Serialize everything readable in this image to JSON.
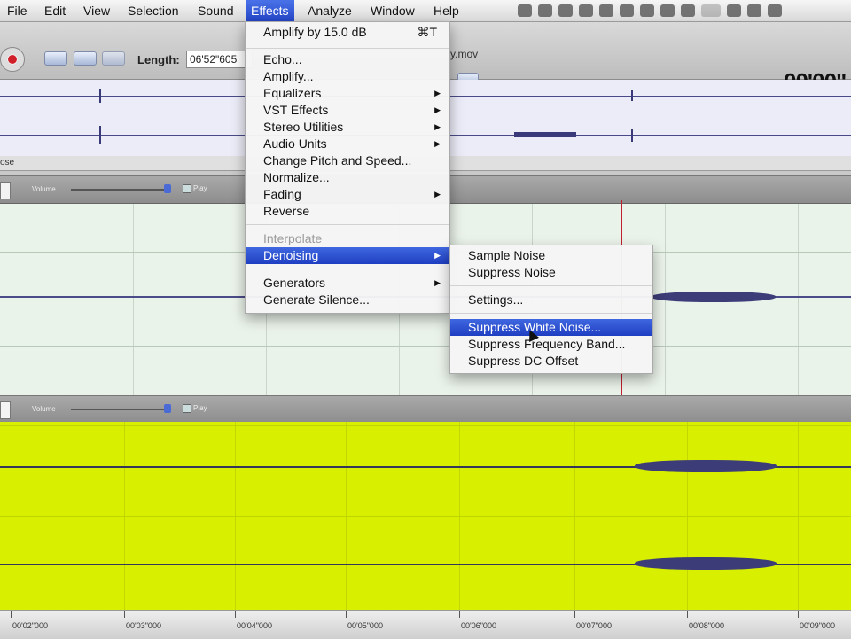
{
  "menubar": {
    "items": [
      "File",
      "Edit",
      "View",
      "Selection",
      "Sound",
      "Effects",
      "Analyze",
      "Window",
      "Help"
    ],
    "active": "Effects"
  },
  "toolbar": {
    "length_label": "Length:",
    "length_value": "06'52\"605",
    "file_title": "y.mov",
    "time_display": "00'00\""
  },
  "overview": {
    "label": "ose"
  },
  "track_header": {
    "volume_label": "Volume",
    "play_label": "Play"
  },
  "effects_menu": {
    "items": [
      {
        "label": "Amplify by 15.0 dB",
        "shortcut": "⌘T"
      },
      {
        "label": "Echo..."
      },
      {
        "label": "Amplify..."
      },
      {
        "label": "Equalizers",
        "submenu": true
      },
      {
        "label": "VST Effects",
        "submenu": true
      },
      {
        "label": "Stereo Utilities",
        "submenu": true
      },
      {
        "label": "Audio Units",
        "submenu": true
      },
      {
        "label": "Change Pitch and Speed..."
      },
      {
        "label": "Normalize..."
      },
      {
        "label": "Fading",
        "submenu": true
      },
      {
        "label": "Reverse"
      },
      {
        "label": "Interpolate",
        "disabled": true
      },
      {
        "label": "Denoising",
        "submenu": true,
        "highlighted": true
      },
      {
        "label": "Generators",
        "submenu": true
      },
      {
        "label": "Generate Silence..."
      }
    ]
  },
  "denoising_menu": {
    "items": [
      {
        "label": "Sample Noise"
      },
      {
        "label": "Suppress Noise"
      },
      {
        "label": "Settings..."
      },
      {
        "label": "Suppress White Noise...",
        "highlighted": true
      },
      {
        "label": "Suppress Frequency Band..."
      },
      {
        "label": "Suppress DC Offset"
      }
    ]
  },
  "ruler": {
    "labels": [
      "00'02\"000",
      "00'03\"000",
      "00'04\"000",
      "00'05\"000",
      "00'06\"000",
      "00'07\"000",
      "00'08\"000",
      "00'09\"000"
    ]
  },
  "colors": {
    "selection": "#d8f000",
    "highlight": "#2546c8",
    "cursor": "#c02030",
    "waveform": "#3c3c78"
  }
}
